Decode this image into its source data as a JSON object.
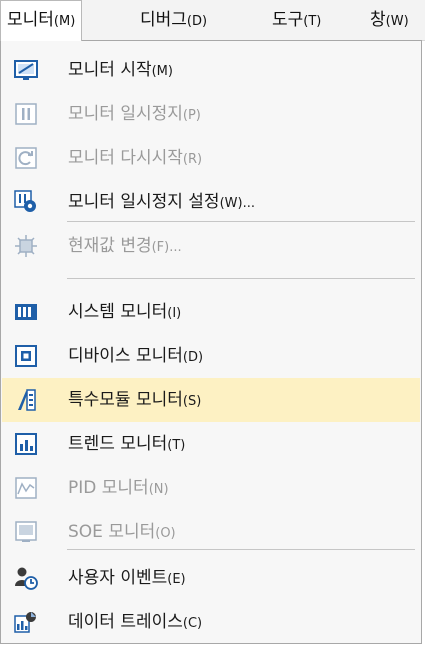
{
  "menubar": {
    "items": [
      {
        "label": "모니터",
        "accel": "(M)"
      },
      {
        "label": "디버그",
        "accel": "(D)"
      },
      {
        "label": "도구",
        "accel": "(T)"
      },
      {
        "label": "창",
        "accel": "(W)"
      }
    ]
  },
  "menu": {
    "items": [
      {
        "label": "모니터 시작",
        "accel": "(M)",
        "icon": "monitor-start-icon",
        "enabled": true
      },
      {
        "label": "모니터 일시정지",
        "accel": "(P)",
        "icon": "pause-icon",
        "enabled": false
      },
      {
        "label": "모니터 다시시작",
        "accel": "(R)",
        "icon": "restart-icon",
        "enabled": false
      },
      {
        "label": "모니터 일시정지 설정",
        "accel": "(W)...",
        "icon": "pause-settings-icon",
        "enabled": true
      },
      {
        "label": "현재값 변경",
        "accel": "(F)...",
        "icon": "change-value-icon",
        "enabled": false
      },
      {
        "label": "시스템 모니터",
        "accel": "(I)",
        "icon": "system-monitor-icon",
        "enabled": true
      },
      {
        "label": "디바이스 모니터",
        "accel": "(D)",
        "icon": "device-monitor-icon",
        "enabled": true
      },
      {
        "label": "특수모듈 모니터",
        "accel": "(S)",
        "icon": "special-module-icon",
        "enabled": true,
        "highlighted": true
      },
      {
        "label": "트렌드 모니터",
        "accel": "(T)",
        "icon": "trend-monitor-icon",
        "enabled": true
      },
      {
        "label": "PID 모니터",
        "accel": "(N)",
        "icon": "pid-monitor-icon",
        "enabled": false
      },
      {
        "label": "SOE 모니터",
        "accel": "(O)",
        "icon": "soe-monitor-icon",
        "enabled": false
      },
      {
        "label": "사용자 이벤트",
        "accel": "(E)",
        "icon": "user-event-icon",
        "enabled": true
      },
      {
        "label": "데이터 트레이스",
        "accel": "(C)",
        "icon": "data-trace-icon",
        "enabled": true
      }
    ]
  },
  "colors": {
    "highlight": "#fdf1c3",
    "disabled_text": "#9a9a9a",
    "menu_bg": "#f7f7f7",
    "icon_blue": "#1f5fa8"
  }
}
